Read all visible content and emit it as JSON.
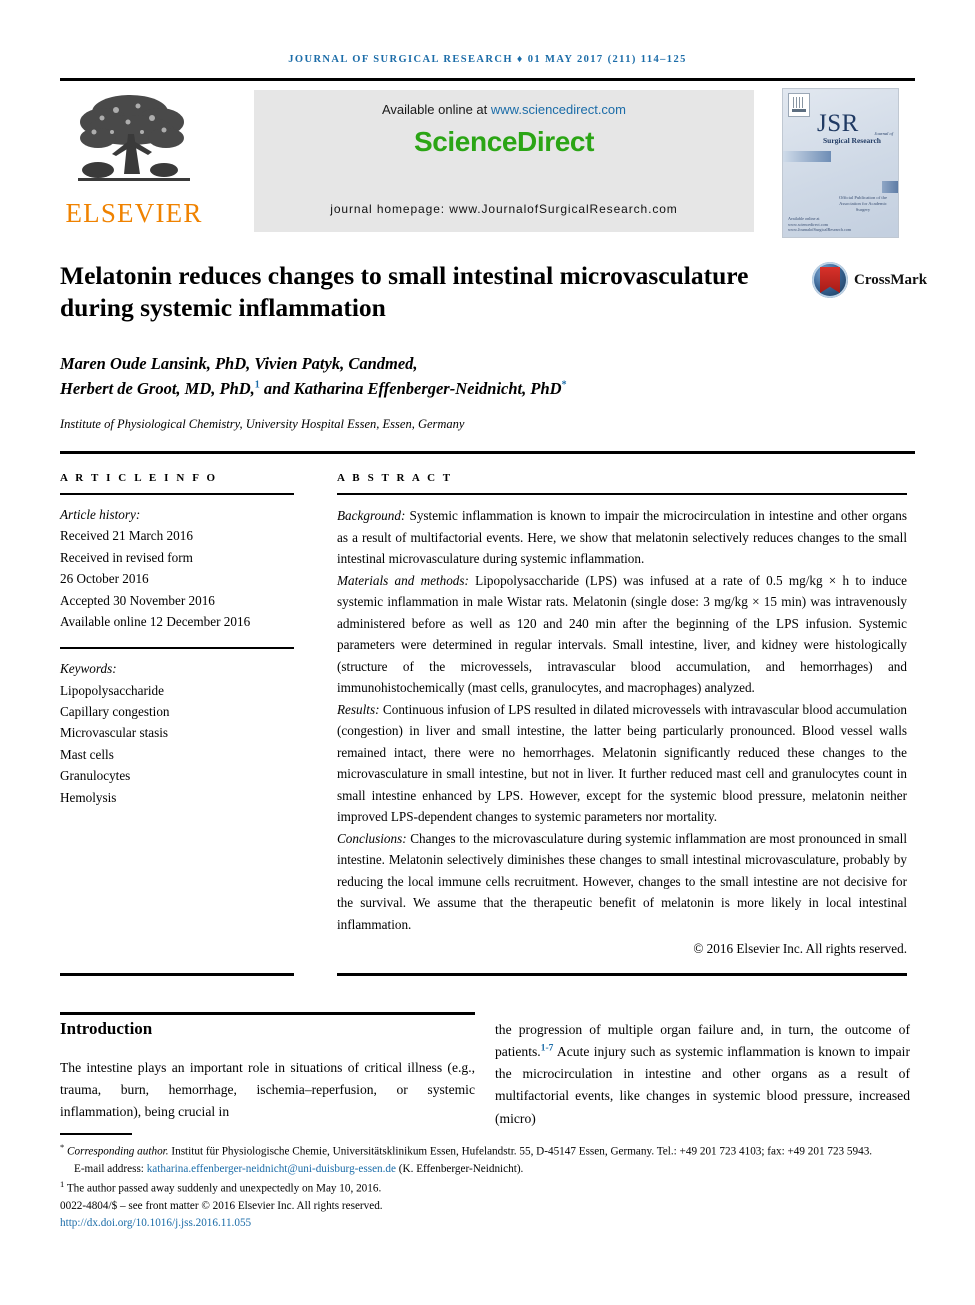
{
  "running_head": "JOURNAL OF SURGICAL RESEARCH ♦ 01 MAY 2017 (211) 114–125",
  "masthead": {
    "publisher": "ELSEVIER",
    "available_online_prefix": "Available online at ",
    "sciencedirect_url": "www.sciencedirect.com",
    "sciencedirect_logo": "ScienceDirect",
    "journal_homepage": "journal homepage: www.JournalofSurgicalResearch.com",
    "cover": {
      "acronym": "JSR",
      "journal_of": "Journal of",
      "subtitle": "Surgical Research",
      "association": "Official Publication of the Association for Academic Surgery",
      "footer": "Available online at www.sciencedirect.com www.JournalofSurgicalResearch.com"
    }
  },
  "article": {
    "title": "Melatonin reduces changes to small intestinal microvasculature during systemic inflammation",
    "crossmark_label": "CrossMark",
    "authors_line1": "Maren Oude Lansink, PhD, Vivien Patyk, Candmed,",
    "authors_line2_a": "Herbert de Groot, MD, PhD,",
    "authors_line2_mark1": "1",
    "authors_line2_b": " and Katharina Effenberger-Neidnicht, PhD",
    "authors_line2_mark2": "*",
    "affiliation": "Institute of Physiological Chemistry, University Hospital Essen, Essen, Germany"
  },
  "article_info": {
    "heading": "A R T I C L E   I N F O",
    "history_label": "Article history:",
    "history": [
      "Received 21 March 2016",
      "Received in revised form",
      "26 October 2016",
      "Accepted 30 November 2016",
      "Available online 12 December 2016"
    ],
    "keywords_label": "Keywords:",
    "keywords": [
      "Lipopolysaccharide",
      "Capillary congestion",
      "Microvascular stasis",
      "Mast cells",
      "Granulocytes",
      "Hemolysis"
    ]
  },
  "abstract": {
    "heading": "A B S T R A C T",
    "sections": [
      {
        "label": "Background:",
        "text": " Systemic inflammation is known to impair the microcirculation in intestine and other organs as a result of multifactorial events. Here, we show that melatonin selectively reduces changes to the small intestinal microvasculature during systemic inflammation."
      },
      {
        "label": "Materials and methods:",
        "text": " Lipopolysaccharide (LPS) was infused at a rate of 0.5 mg/kg × h to induce systemic inflammation in male Wistar rats. Melatonin (single dose: 3 mg/kg × 15 min) was intravenously administered before as well as 120 and 240 min after the beginning of the LPS infusion. Systemic parameters were determined in regular intervals. Small intestine, liver, and kidney were histologically (structure of the microvessels, intravascular blood accumulation, and hemorrhages) and immunohistochemically (mast cells, granulocytes, and macrophages) analyzed."
      },
      {
        "label": "Results:",
        "text": " Continuous infusion of LPS resulted in dilated microvessels with intravascular blood accumulation (congestion) in liver and small intestine, the latter being particularly pronounced. Blood vessel walls remained intact, there were no hemorrhages. Melatonin significantly reduced these changes to the microvasculature in small intestine, but not in liver. It further reduced mast cell and granulocytes count in small intestine enhanced by LPS. However, except for the systemic blood pressure, melatonin neither improved LPS-dependent changes to systemic parameters nor mortality."
      },
      {
        "label": "Conclusions:",
        "text": " Changes to the microvasculature during systemic inflammation are most pronounced in small intestine. Melatonin selectively diminishes these changes to small intestinal microvasculature, probably by reducing the local immune cells recruitment. However, changes to the small intestine are not decisive for the survival. We assume that the therapeutic benefit of melatonin is more likely in local intestinal inflammation."
      }
    ],
    "copyright": "© 2016 Elsevier Inc. All rights reserved."
  },
  "body": {
    "intro_heading": "Introduction",
    "left_column": "The intestine plays an important role in situations of critical illness (e.g., trauma, burn, hemorrhage, ischemia–reperfusion, or systemic inflammation), being crucial in",
    "right_column_a": "the progression of multiple organ failure and, in turn, the outcome of patients.",
    "right_column_ref": "1-7",
    "right_column_b": " Acute injury such as systemic inflammation is known to impair the microcirculation in intestine and other organs as a result of multifactorial events, like changes in systemic blood pressure, increased (micro)"
  },
  "footnotes": {
    "corresponding_marker": "*",
    "corresponding_label": "Corresponding author.",
    "corresponding_text": " Institut für Physiologische Chemie, Universitätsklinikum Essen, Hufelandstr. 55, D-45147 Essen, Germany. Tel.: +49 201 723 4103; fax: +49 201 723 5943.",
    "email_label": "E-mail address: ",
    "email": "katharina.effenberger-neidnicht@uni-duisburg-essen.de",
    "email_suffix": " (K. Effenberger-Neidnicht).",
    "death_marker": "1",
    "death_note": " The author passed away suddenly and unexpectedly on May 10, 2016.",
    "front_matter": "0022-4804/$ – see front matter © 2016 Elsevier Inc. All rights reserved.",
    "doi": "http://dx.doi.org/10.1016/j.jss.2016.11.055"
  },
  "colors": {
    "link_blue": "#1b6ca8",
    "sciencedirect_green": "#2ba515",
    "elsevier_orange": "#ef8200",
    "panel_gray": "#e6e6e6"
  }
}
